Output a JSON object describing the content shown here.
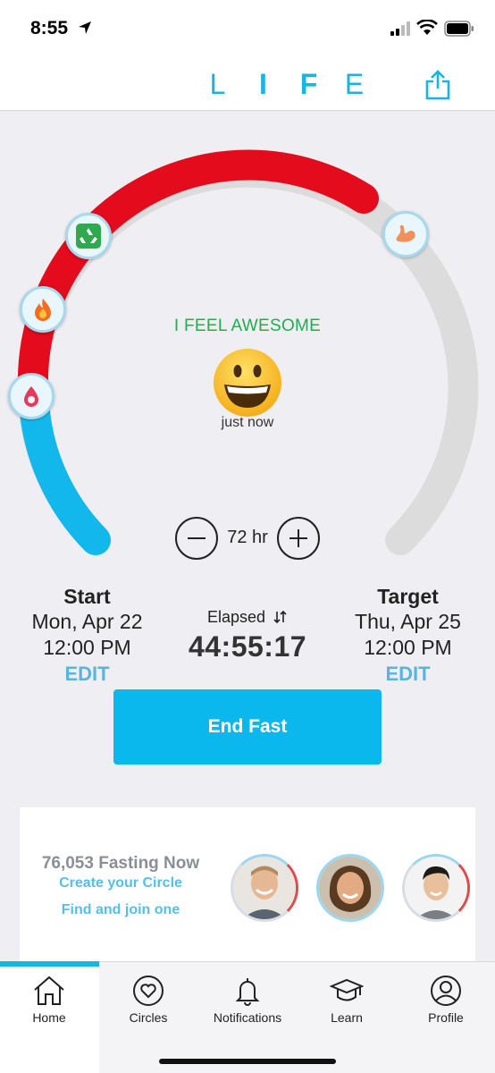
{
  "status_bar": {
    "time": "8:55"
  },
  "header": {
    "logo_letters": [
      "L",
      "I",
      "F",
      "E"
    ],
    "share_icon": "share-icon"
  },
  "gauge": {
    "progress_fraction": 0.62,
    "elapsed_color": "#e30b1c",
    "early_color": "#12b8ec",
    "remaining_color": "#dcdcdc",
    "milestones": [
      "droplet-milestone-icon",
      "flame-milestone-icon",
      "recycle-milestone-icon",
      "muscle-milestone-icon"
    ]
  },
  "mood": {
    "label": "I FEEL AWESOME",
    "emoji": "grinning-face",
    "time": "just now"
  },
  "duration": {
    "value": "72 hr"
  },
  "start": {
    "title": "Start",
    "date": "Mon, Apr 22",
    "time": "12:00 PM",
    "edit": "EDIT"
  },
  "elapsed": {
    "label": "Elapsed",
    "value": "44:55:17"
  },
  "target": {
    "title": "Target",
    "date": "Thu, Apr 25",
    "time": "12:00 PM",
    "edit": "EDIT"
  },
  "end_button": {
    "label": "End Fast"
  },
  "community": {
    "count_text": "76,053 Fasting Now",
    "create_link": "Create your Circle",
    "find_link": "Find and join one"
  },
  "tabs": [
    {
      "label": "Home",
      "icon": "home-icon",
      "active": true
    },
    {
      "label": "Circles",
      "icon": "heart-circle-icon",
      "active": false
    },
    {
      "label": "Notifications",
      "icon": "bell-icon",
      "active": false
    },
    {
      "label": "Learn",
      "icon": "graduation-cap-icon",
      "active": false
    },
    {
      "label": "Profile",
      "icon": "profile-icon",
      "active": false
    }
  ]
}
